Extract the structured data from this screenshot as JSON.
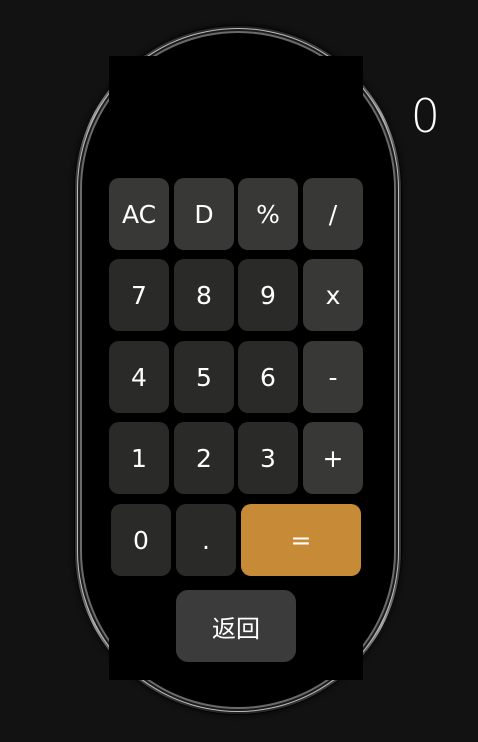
{
  "display": {
    "value": "0"
  },
  "keys": {
    "row1": [
      "AC",
      "D",
      "%",
      "/"
    ],
    "row2": [
      "7",
      "8",
      "9",
      "x"
    ],
    "row3": [
      "4",
      "5",
      "6",
      "-"
    ],
    "row4": [
      "1",
      "2",
      "3",
      "+"
    ],
    "row5": [
      "0",
      ".",
      "="
    ]
  },
  "back_button": {
    "label": "返回"
  },
  "colors": {
    "background": "#121212",
    "screen": "#000000",
    "key": "#2a2b29",
    "operator_key": "#383937",
    "equals_key": "#c78a36",
    "back_button": "#3b3b3b",
    "text": "#ffffff"
  }
}
